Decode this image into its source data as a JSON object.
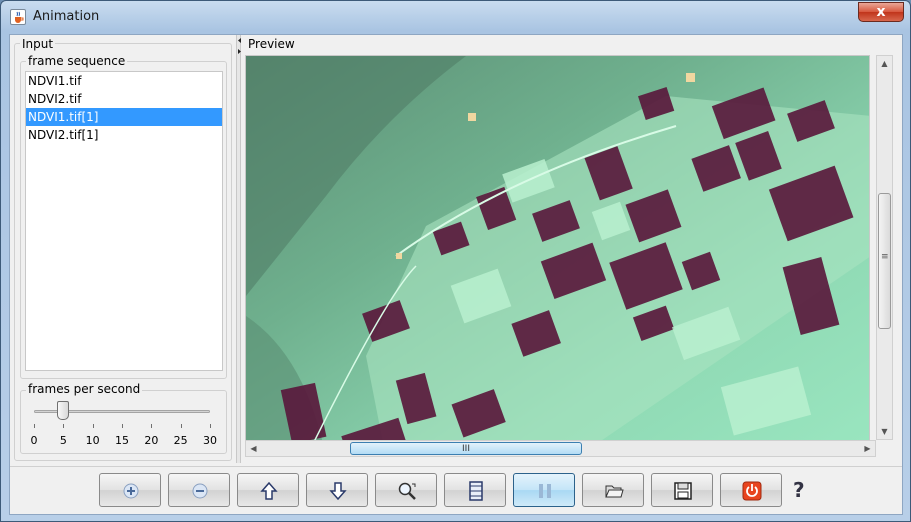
{
  "window": {
    "title": "Animation",
    "close_label": "x"
  },
  "input": {
    "title": "Input",
    "frame_sequence": {
      "title": "frame sequence",
      "items": [
        {
          "label": "NDVI1.tif",
          "selected": false
        },
        {
          "label": "NDVI2.tif",
          "selected": false
        },
        {
          "label": "NDVI1.tif[1]",
          "selected": true
        },
        {
          "label": "NDVI2.tif[1]",
          "selected": false
        }
      ]
    },
    "fps": {
      "title": "frames per second",
      "value": 5,
      "min": 0,
      "max": 30,
      "ticks": [
        "0",
        "5",
        "10",
        "15",
        "20",
        "25",
        "30"
      ]
    }
  },
  "preview": {
    "title": "Preview",
    "hscroll_grip": "III",
    "vscroll_grip": "≡"
  },
  "toolbar": {
    "buttons": [
      {
        "name": "add-button",
        "icon": "plus-icon"
      },
      {
        "name": "remove-button",
        "icon": "minus-icon"
      },
      {
        "name": "move-up-button",
        "icon": "arrow-up-icon"
      },
      {
        "name": "move-down-button",
        "icon": "arrow-down-icon"
      },
      {
        "name": "zoom-button",
        "icon": "magnifier-icon"
      },
      {
        "name": "frames-button",
        "icon": "film-strip-icon"
      },
      {
        "name": "pause-button",
        "icon": "pause-icon",
        "pressed": true
      },
      {
        "name": "open-button",
        "icon": "folder-icon"
      },
      {
        "name": "save-button",
        "icon": "floppy-icon"
      },
      {
        "name": "exit-button",
        "icon": "power-icon"
      }
    ],
    "help_label": "?"
  },
  "colors": {
    "selection": "#3399ff",
    "crop_dark": "#5a1a3c",
    "vegetation_light": "#9ee6c0",
    "background_green": "#7fcaa5"
  }
}
